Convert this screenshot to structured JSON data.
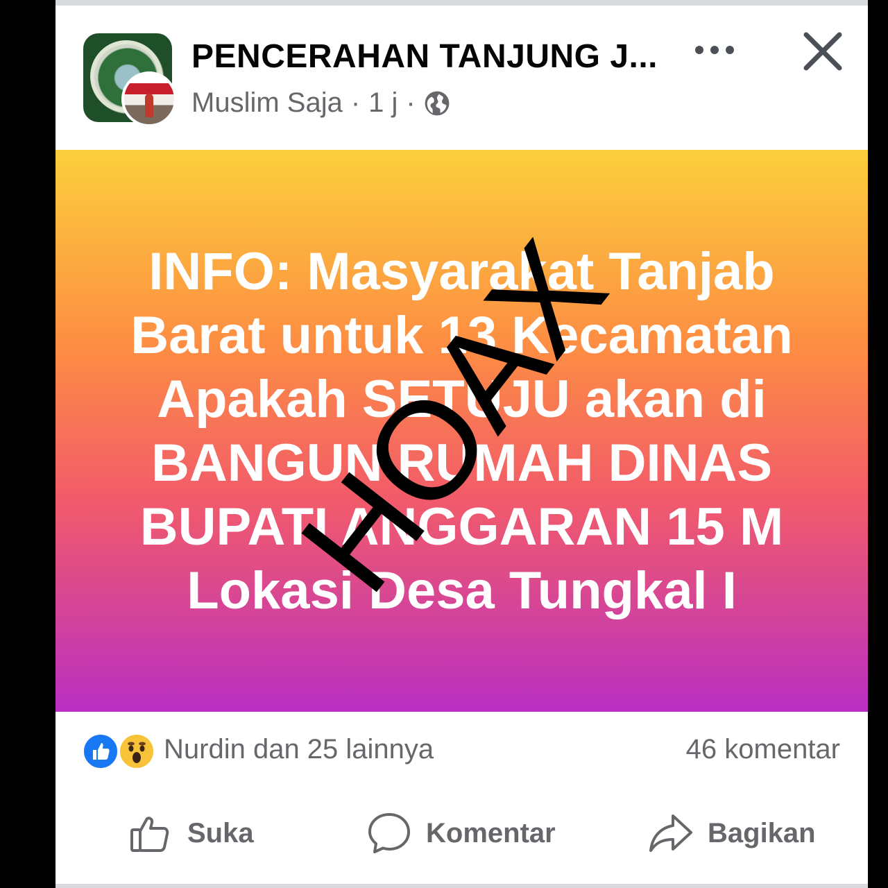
{
  "header": {
    "page_name": "PENCERAHAN TANJUNG J...",
    "author": "Muslim Saja",
    "separator": "·",
    "time": "1 j",
    "audience_icon": "globe-icon",
    "more_icon": "more-horizontal-icon",
    "close_icon": "close-icon"
  },
  "post": {
    "text": "INFO: Masyarakat Tanjab\nBarat untuk 13 Kecamatan\nApakah SETUJU akan di\nBANGUN RUMAH DINAS\nBUPATI ANGGARAN 15 M\nLokasi Desa Tungkal I",
    "overlay_stamp": "HOAX",
    "background_colors": [
      "#fccf3c",
      "#fd8d43",
      "#f25b6a",
      "#b92fc2"
    ]
  },
  "reactions": {
    "icons": [
      "like-reaction-icon",
      "wow-reaction-icon"
    ],
    "reactors": "Nurdin dan 25 lainnya",
    "comments": "46 komentar"
  },
  "actions": {
    "like_label": "Suka",
    "comment_label": "Komentar",
    "share_label": "Bagikan"
  },
  "colors": {
    "text_primary": "#050505",
    "text_secondary": "#65676b",
    "like_blue": "#1877f2"
  }
}
